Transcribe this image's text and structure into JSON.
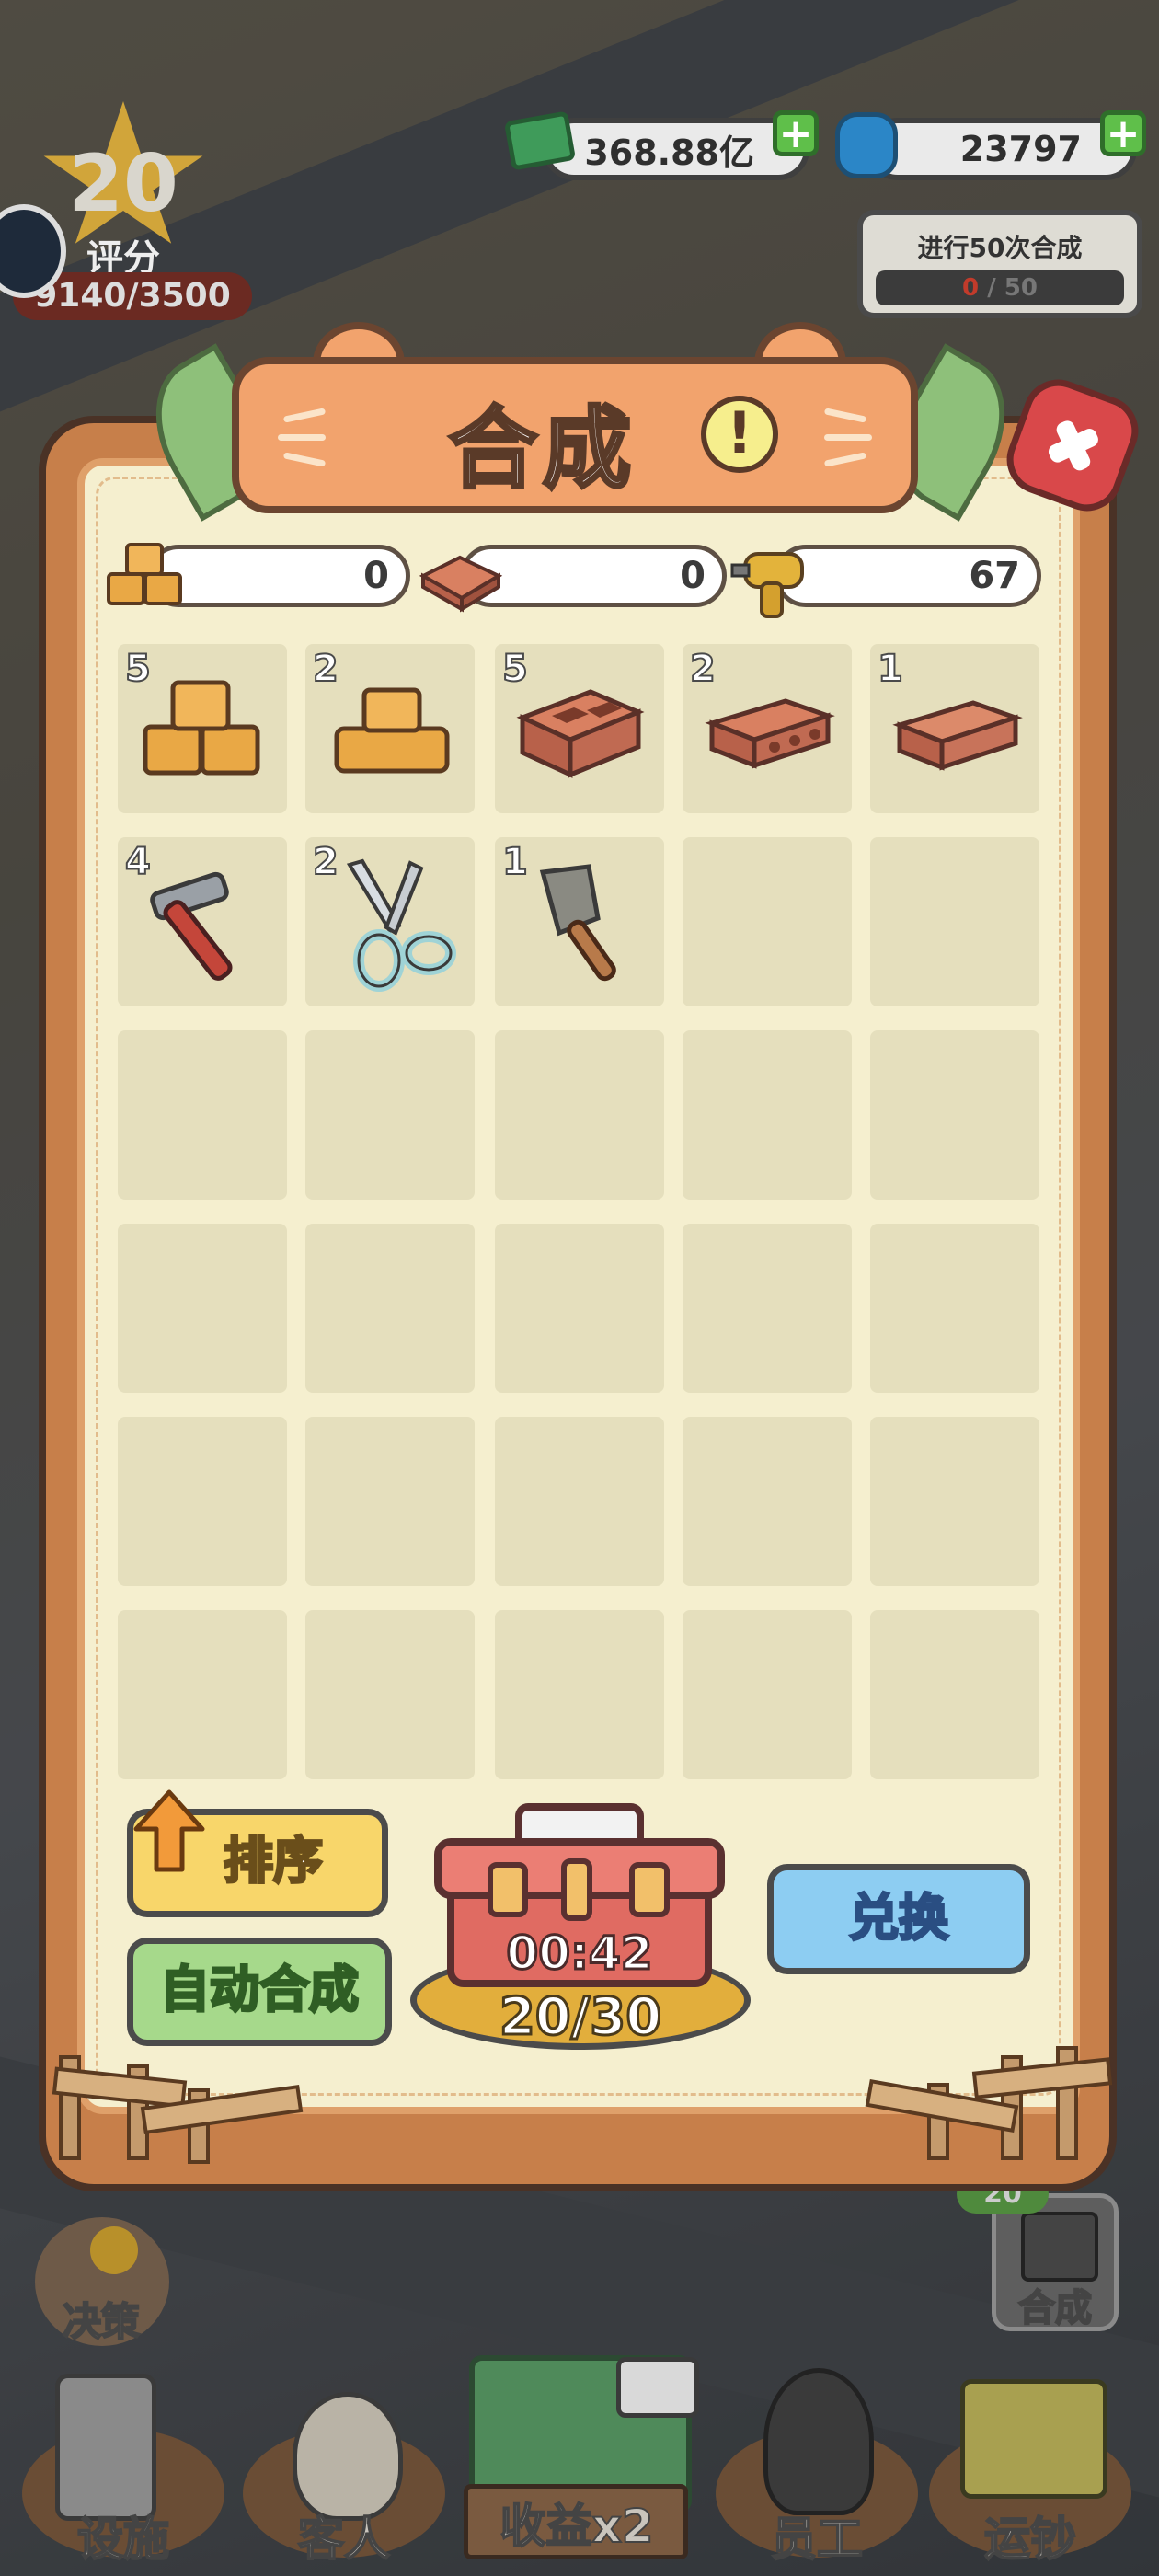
{
  "hud": {
    "cash": "368.88亿",
    "gems": "23797",
    "plus_symbol": "+",
    "rating": {
      "level": "20",
      "label": "评分",
      "progress": "9140/3500"
    },
    "task": {
      "title": "进行50次合成",
      "current": "0",
      "total": "/ 50"
    }
  },
  "dialog": {
    "title": "合成",
    "info_symbol": "!",
    "resources": [
      {
        "icon": "wood-blocks-icon",
        "value": "0"
      },
      {
        "icon": "brick-mold-icon",
        "value": "0"
      },
      {
        "icon": "power-drill-icon",
        "value": "67"
      }
    ],
    "items": [
      {
        "icon": "wood-blocks-large-icon",
        "count": "5"
      },
      {
        "icon": "wood-blocks-small-icon",
        "count": "2"
      },
      {
        "icon": "hollow-brick-icon",
        "count": "5"
      },
      {
        "icon": "perforated-brick-icon",
        "count": "2"
      },
      {
        "icon": "solid-brick-icon",
        "count": "1"
      },
      {
        "icon": "hammer-icon",
        "count": "4"
      },
      {
        "icon": "scissors-icon",
        "count": "2"
      },
      {
        "icon": "trowel-icon",
        "count": "1"
      }
    ],
    "buttons": {
      "sort": "排序",
      "auto_merge": "自动合成",
      "exchange": "兑换"
    },
    "chest": {
      "timer": "00:42",
      "count": "20/30"
    }
  },
  "side": {
    "merge_shortcut": "合成",
    "merge_badge": "20"
  },
  "nav": {
    "decision": "决策",
    "items": [
      {
        "label": "设施",
        "icon": "atm-machine-icon"
      },
      {
        "label": "客人",
        "icon": "bunny-guest-icon"
      },
      {
        "label": "收益x2",
        "icon": "cash-stack-icon"
      },
      {
        "label": "员工",
        "icon": "cat-staff-icon"
      },
      {
        "label": "运钞",
        "icon": "money-cart-icon"
      }
    ]
  },
  "colors": {
    "panel": "#f5efcf",
    "frame": "#c77f4a",
    "accent_green": "#a6d98b",
    "accent_blue": "#8dcdf2",
    "accent_yellow": "#f8d66a",
    "close_red": "#d9484a"
  }
}
